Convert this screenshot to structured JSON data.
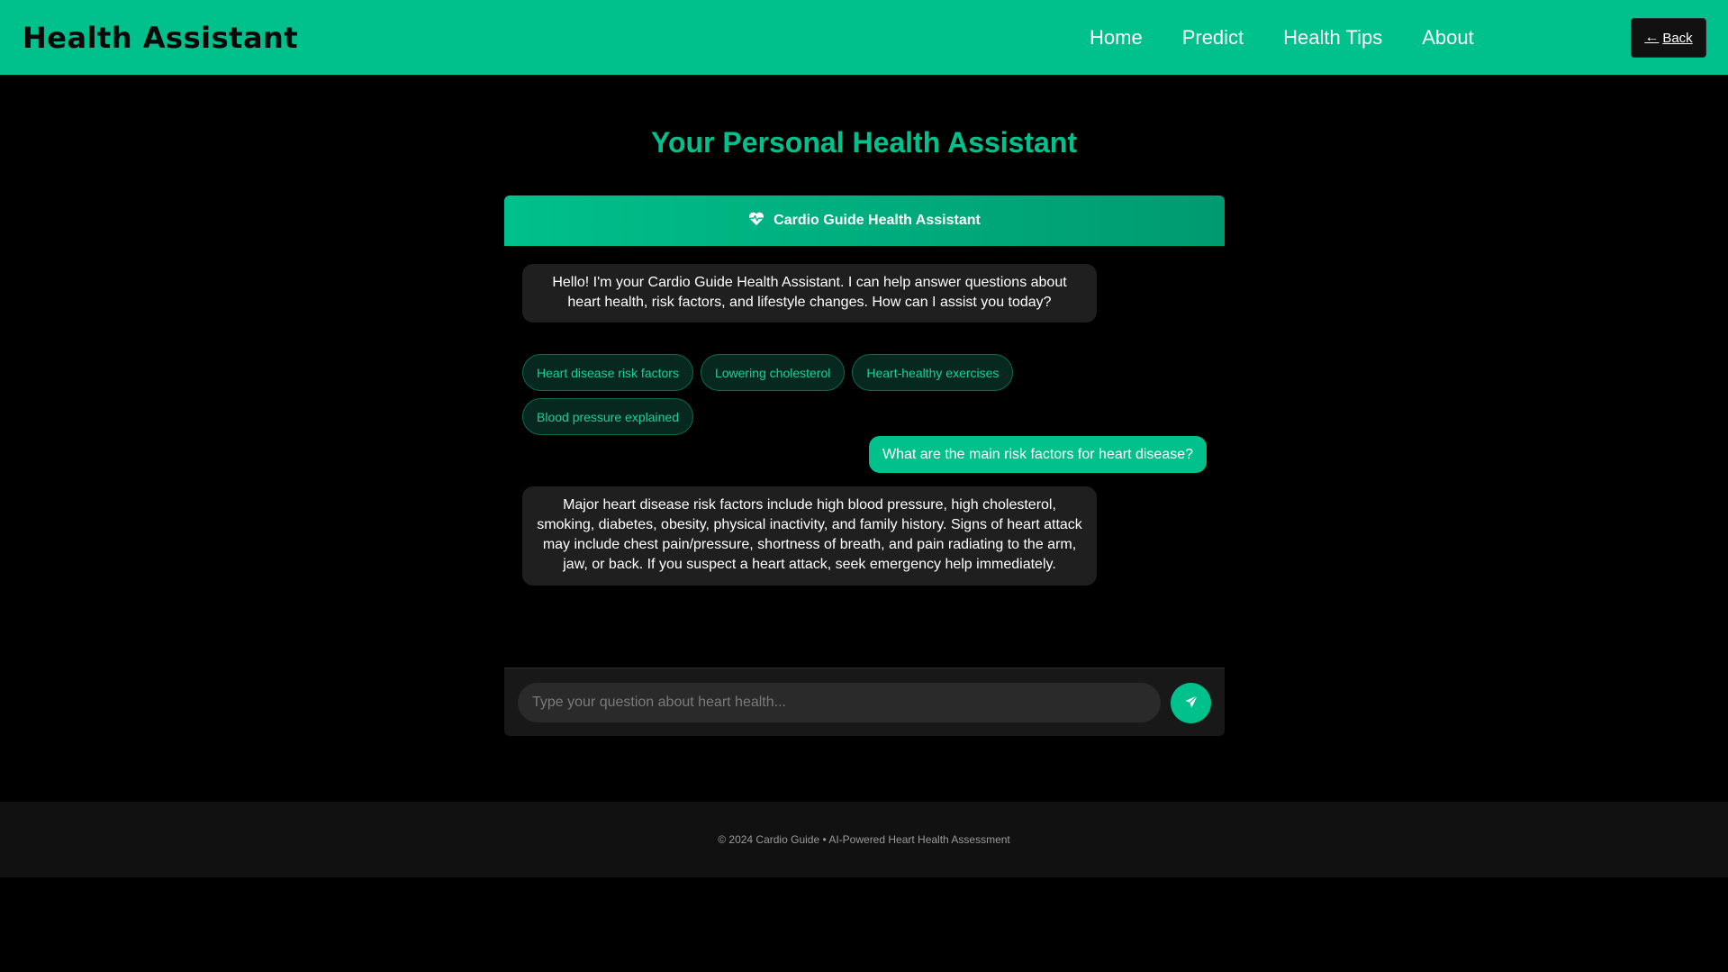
{
  "navbar": {
    "brand": "Health Assistant",
    "links": [
      "Home",
      "Predict",
      "Health Tips",
      "About"
    ],
    "back_arrow": "←",
    "back_label": "Back"
  },
  "page": {
    "title": "Your Personal Health Assistant"
  },
  "chat": {
    "header_icon": "heart-pulse-icon",
    "header_title": "Cardio Guide Health Assistant",
    "bot_greeting": "Hello! I'm your Cardio Guide Health Assistant. I can help answer questions about heart health, risk factors, and lifestyle changes. How can I assist you today?",
    "suggestions": [
      "Heart disease risk factors",
      "Lowering cholesterol",
      "Heart-healthy exercises",
      "Blood pressure explained"
    ],
    "user_message": "What are the main risk factors for heart disease?",
    "bot_reply": "Major heart disease risk factors include high blood pressure, high cholesterol, smoking, diabetes, obesity, physical inactivity, and family history. Signs of heart attack may include chest pain/pressure, shortness of breath, and pain radiating to the arm, jaw, or back. If you suspect a heart attack, seek emergency help immediately.",
    "input_placeholder": "Type your question about heart health...",
    "send_icon": "paper-plane-icon"
  },
  "footer": {
    "text": "© 2024 Cardio Guide • AI-Powered Heart Health Assessment"
  },
  "colors": {
    "accent": "#00c08b",
    "background": "#000000",
    "bubble": "#1f1f1f"
  }
}
